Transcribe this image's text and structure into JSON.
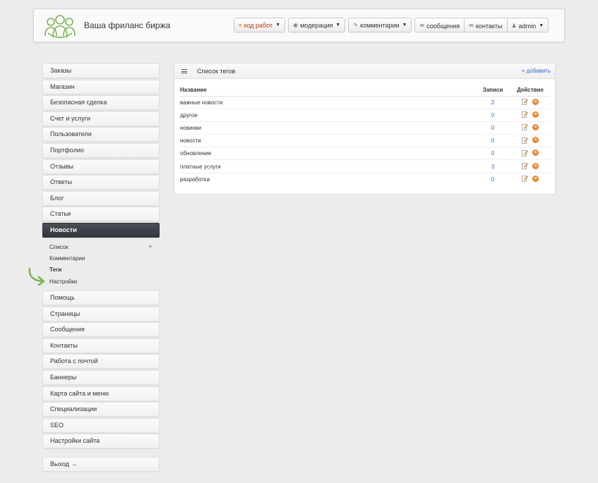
{
  "header": {
    "site_title": "Ваша фриланс биржа",
    "nav": [
      {
        "label": "ход работ",
        "icon": "shield-icon"
      },
      {
        "label": "модерация",
        "icon": "eye-icon"
      },
      {
        "label": "комментарии",
        "icon": "pencil-icon"
      },
      {
        "label": "сообщения",
        "icon": "envelope-icon"
      },
      {
        "label": "контакты",
        "icon": "envelope-icon"
      },
      {
        "label": "admin",
        "icon": "user-icon"
      }
    ]
  },
  "sidebar": {
    "items_top": [
      "Заказы",
      "Магазин",
      "Безопасная сделка",
      "Счет и услуги",
      "Пользователи",
      "Портфолио",
      "Отзывы",
      "Ответы",
      "Блог",
      "Статьи"
    ],
    "active": "Новости",
    "sub_items": [
      "Список",
      "Комментарии",
      "Теги",
      "Настройки"
    ],
    "items_bottom": [
      "Помощь",
      "Страницы",
      "Сообщения",
      "Контакты",
      "Работа с почтой",
      "Баннеры",
      "Карта сайта и меню",
      "Специализации",
      "SEO",
      "Настройки сайта"
    ],
    "logout": "Выход →"
  },
  "panel": {
    "title": "Список тегов",
    "add_label": "+ добавить",
    "columns": {
      "name": "Название",
      "count": "Записи",
      "action": "Действие"
    },
    "rows": [
      {
        "name": "важные новости",
        "count": "2"
      },
      {
        "name": "другое",
        "count": "0"
      },
      {
        "name": "новинки",
        "count": "0"
      },
      {
        "name": "новости",
        "count": "0"
      },
      {
        "name": "обновление",
        "count": "0"
      },
      {
        "name": "платные услуги",
        "count": "3"
      },
      {
        "name": "разработка",
        "count": "0"
      }
    ]
  },
  "colors": {
    "accent_link": "#2a6cc4",
    "active_bg": "#3a3d43",
    "logo_green": "#7bb551",
    "delete_orange": "#e8862a"
  }
}
